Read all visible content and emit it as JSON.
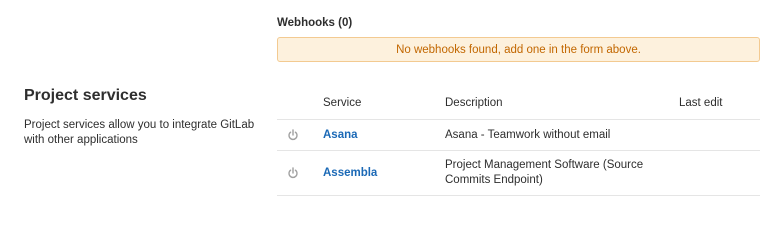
{
  "webhooks": {
    "title": "Webhooks (0)",
    "empty_message": "No webhooks found, add one in the form above."
  },
  "project_services": {
    "heading": "Project services",
    "description": "Project services allow you to integrate GitLab with other applications"
  },
  "services_table": {
    "headers": {
      "status": "",
      "service": "Service",
      "description": "Description",
      "last_edit": "Last edit"
    },
    "rows": [
      {
        "status_icon": "power-icon",
        "service": "Asana",
        "description": "Asana - Teamwork without email",
        "last_edit": ""
      },
      {
        "status_icon": "power-icon",
        "service": "Assembla",
        "description": "Project Management Software (Source Commits Endpoint)",
        "last_edit": ""
      }
    ]
  },
  "colors": {
    "link": "#1b69b6",
    "alert_bg": "#fdf1dd",
    "alert_border": "#f3ca91",
    "alert_text": "#c26700",
    "icon_grey": "#a0a0a0"
  }
}
